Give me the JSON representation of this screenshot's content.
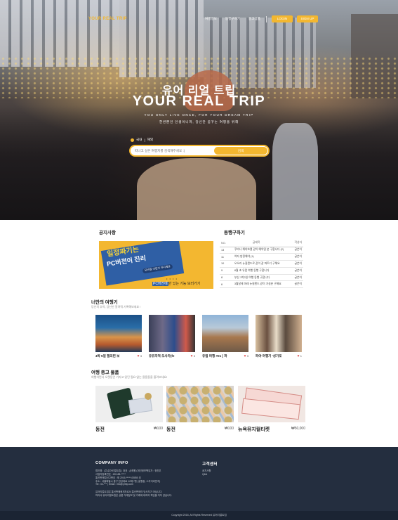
{
  "brand": {
    "logo": "YOUR REAL TRIP",
    "accent": "#f3b730",
    "footer_bg": "#242e3f"
  },
  "nav": {
    "items": [
      "여행정보",
      "동행구하기",
      "중고상품"
    ],
    "login": "LOGIN",
    "join": "SIGN UP"
  },
  "hero": {
    "title_kr": "유어 리얼 트립",
    "title_en": "YOUR REAL TRIP",
    "subtitle_en": "YOU ONLY LIVE ONCE, FOR YOUR DREAM TRIP",
    "subtitle_kr": "한번뿐인 인생이니까, 당신만 꿈꾸는 여행을 위해",
    "region_left": "국내",
    "region_right": "해외",
    "search_placeholder": "떠나고 싶은 여행지를 검색해주세요 :)",
    "search_button": "검색"
  },
  "notice": {
    "title": "공지사항",
    "banner_line1": "일정짜기는",
    "banner_line2": "PC버전이 진리",
    "banner_tag": "모바일 이런거 아니에요",
    "banner_bottom_hl": "PC버전에",
    "banner_bottom_rest": "만 있는 기능 보러가기",
    "banner_dots": "• • • •"
  },
  "companion": {
    "title": "동행구하기",
    "headers": {
      "no": "NO.",
      "title": "글제목",
      "author": "작성자"
    },
    "rows": [
      {
        "no": "13",
        "title": "쿠라나 해야호텔 같이 예약일 분 구합니다 (2)",
        "author": "글쓴이"
      },
      {
        "no": "11",
        "title": "여자 방정해야 (1)",
        "author": "글쓴이"
      },
      {
        "no": "10",
        "title": "오오리 뉴질랜드로 같이 갈 파트너 구해요",
        "author": "글쓴이"
      },
      {
        "no": "9",
        "title": "8월 초 유럽 여행 동행 구합니다",
        "author": "글쓴이"
      },
      {
        "no": "8",
        "title": "부산 1박2일 여행 동행 구합니다",
        "author": "글쓴이"
      },
      {
        "no": "6",
        "title": "3월달에 마레 뉴질랜드 같이 가실분 구해요",
        "author": "글쓴이"
      }
    ]
  },
  "diary": {
    "title": "너만의 여행기",
    "subtitle": "당신의 추억, 당신만 알려줘 기록해보세요 !",
    "cards": [
      {
        "title": "4박 5일 필리핀 보",
        "likes": "3"
      },
      {
        "title": "유유자적 오사카(fe",
        "likes": "3"
      },
      {
        "title": "유럽 여행 #01 [ 파",
        "likes": "3"
      },
      {
        "title": "파야 여행기 '성가포",
        "likes": "1"
      }
    ]
  },
  "goods": {
    "title": "여행 중고 물품",
    "subtitle": "여행하면서 오랫동안 가지고 있던 필요 없는 물품들을 올려보세요!",
    "cards": [
      {
        "title": "동전",
        "price": "₩100"
      },
      {
        "title": "동전",
        "price": "₩100"
      },
      {
        "title": "뉴욕뮤지컬티켓",
        "price": "₩50,000"
      }
    ]
  },
  "footer": {
    "company_title": "COMPANY INFO",
    "company_lines": [
      "법인명 : (주)유어리얼트립 | 대표 : 손혜원 (개인정보책임자 : 정진우",
      "사업자등록번호 : 220-88-*****",
      "통신판매업신고번호 : 제 2016-*****-00850 호",
      "주소 : 서울특별시 중구 한강대로 12에 7층 (갈월동, 스카이라운지)",
      "Tel : 02-*** | Email : info@yrtrip.com",
      "유어리얼트립은 통신판매중개자로서 통신판매의 당사자가 아닙니다.",
      "따라서 유어리얼트립은 상품 거래정보 및 거래에 대하여 책임을 지지 않습니다."
    ],
    "cs_title": "고객센터",
    "cs_links": [
      "공지사항",
      "Q&A"
    ],
    "copyright": "Copyright 2018, All Rights Reserved 유어리얼트립"
  }
}
